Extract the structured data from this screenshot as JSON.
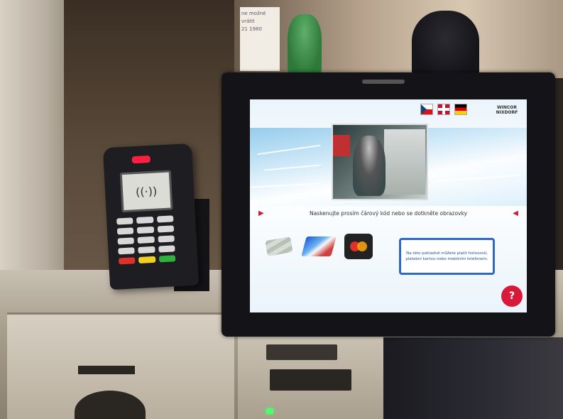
{
  "store_sign": {
    "lines": [
      "ne možné",
      "vrátit",
      "21 1980"
    ]
  },
  "terminal": {
    "screen_icon": "contactless-icon",
    "keypad_colors": {
      "cancel": "#e0302a",
      "clear": "#f0d020",
      "ok": "#30b040"
    }
  },
  "kiosk": {
    "languages": [
      "CZ",
      "EN",
      "DE"
    ],
    "brand": "WINCOR NIXDORF",
    "instruction": "Naskenujte prosím čárový kód nebo se dotkněte obrazovky",
    "payment_methods": [
      "cash-icon",
      "card-icon",
      "maestro-icon"
    ],
    "info_text": "Na této pokladně můžete platit hotovostí, platební kartou nebo mobilním telefonem.",
    "help_label": "?",
    "accent": "#d81a3a",
    "info_border": "#2a6ad0"
  }
}
